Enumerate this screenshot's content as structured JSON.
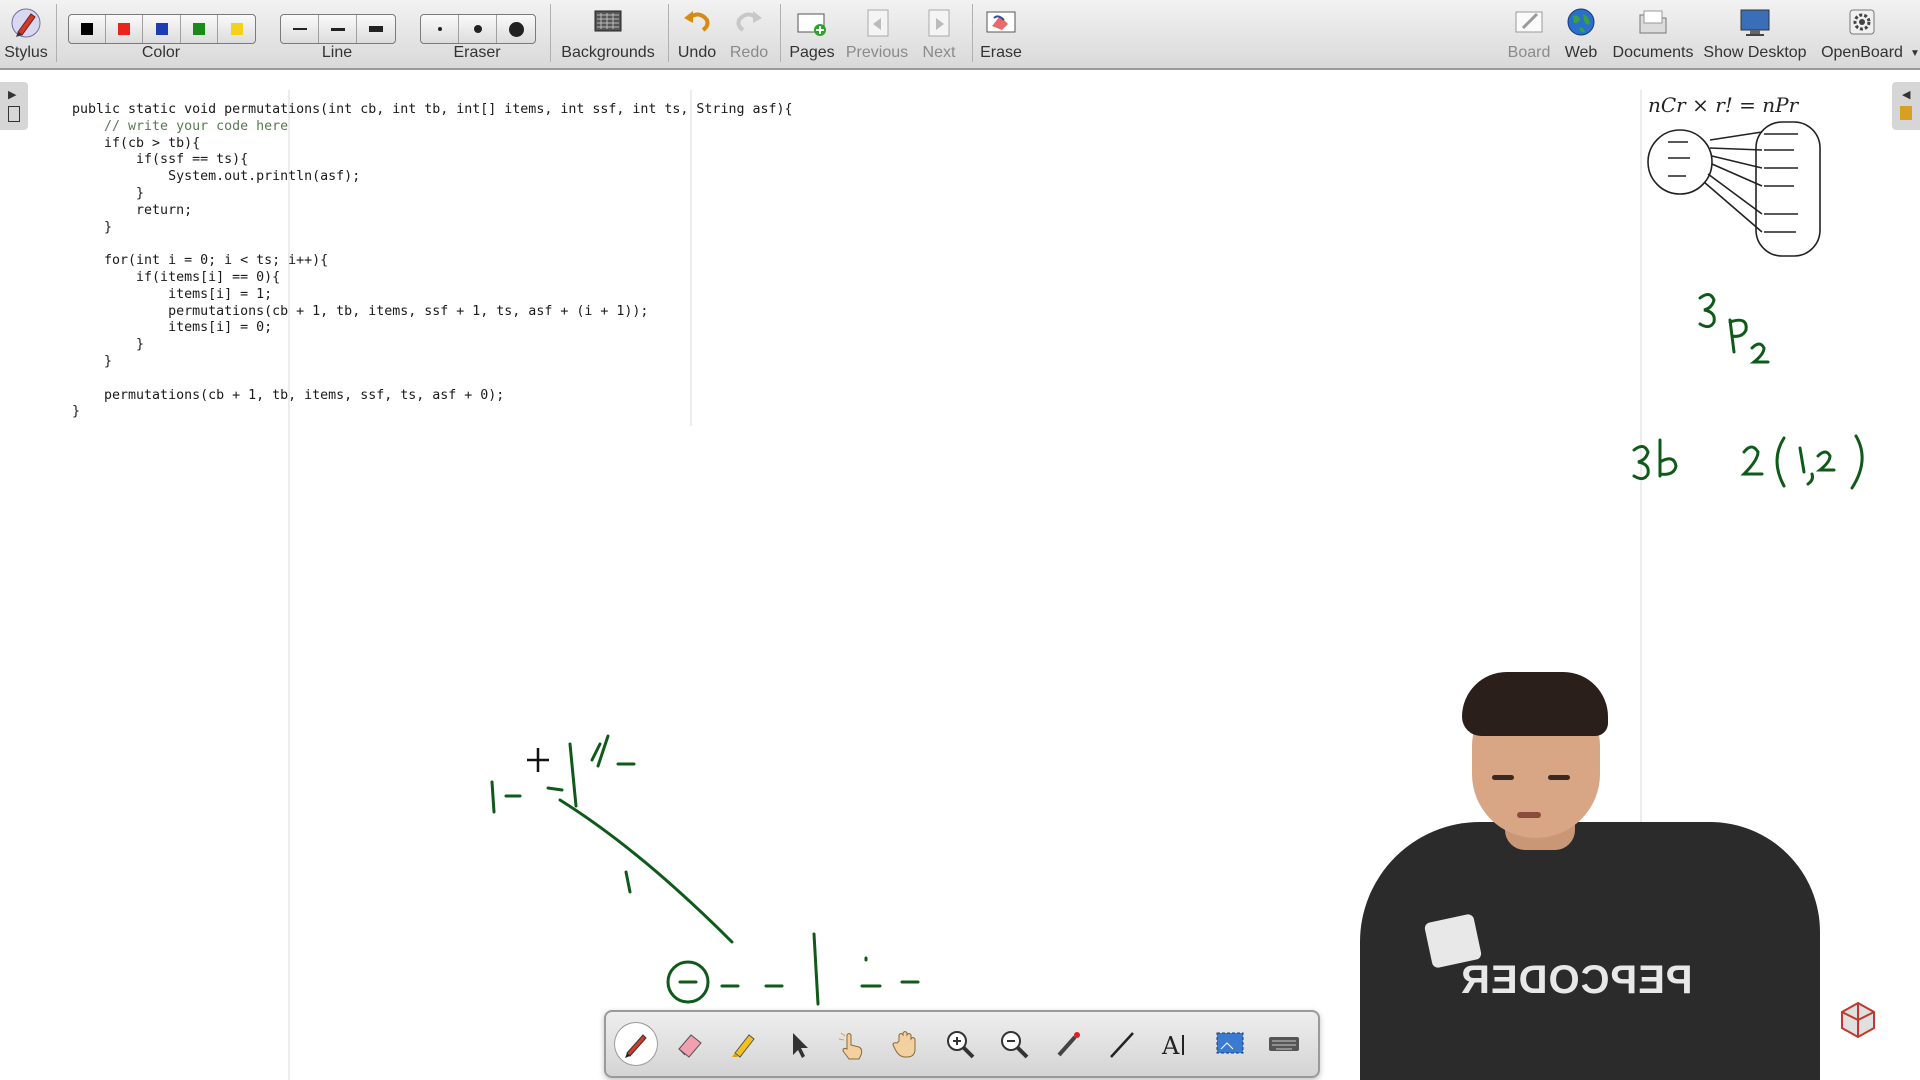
{
  "toolbar": {
    "stylus": "Stylus",
    "color": "Color",
    "line": "Line",
    "eraser": "Eraser",
    "backgrounds": "Backgrounds",
    "undo": "Undo",
    "redo": "Redo",
    "pages": "Pages",
    "previous": "Previous",
    "next": "Next",
    "erase": "Erase",
    "board": "Board",
    "web": "Web",
    "documents": "Documents",
    "show_desktop": "Show Desktop",
    "openboard": "OpenBoard"
  },
  "colors": [
    "#000000",
    "#e8241b",
    "#1d3bb3",
    "#1a8a1a",
    "#f2d21b"
  ],
  "ink_color": "#0f5a1a",
  "code_lines": [
    "public static void permutations(int cb, int tb, int[] items, int ssf, int ts, String asf){",
    "    // write your code here",
    "    if(cb > tb){",
    "        if(ssf == ts){",
    "            System.out.println(asf);",
    "        }",
    "        return;",
    "    }",
    "",
    "    for(int i = 0; i < ts; i++){",
    "        if(items[i] == 0){",
    "            items[i] = 1;",
    "            permutations(cb + 1, tb, items, ssf + 1, ts, asf + (i + 1));",
    "            items[i] = 0;",
    "        }",
    "    }",
    "",
    "    permutations(cb + 1, tb, items, ssf, ts, asf + 0);",
    "}"
  ],
  "handwriting": {
    "formula": "nCr × r! = nPr",
    "perm": "3P2",
    "boxes": "3b",
    "items": "2(1,2)"
  },
  "shirt": {
    "brand": "PEPCODER"
  },
  "dock_tools": [
    "pen-icon",
    "eraser-icon",
    "highlighter-icon",
    "pointer-icon",
    "laser-icon",
    "hand-icon",
    "zoom-in-icon",
    "zoom-out-icon",
    "pointer-pen-icon",
    "line-icon",
    "text-icon",
    "capture-icon",
    "keyboard-icon"
  ]
}
